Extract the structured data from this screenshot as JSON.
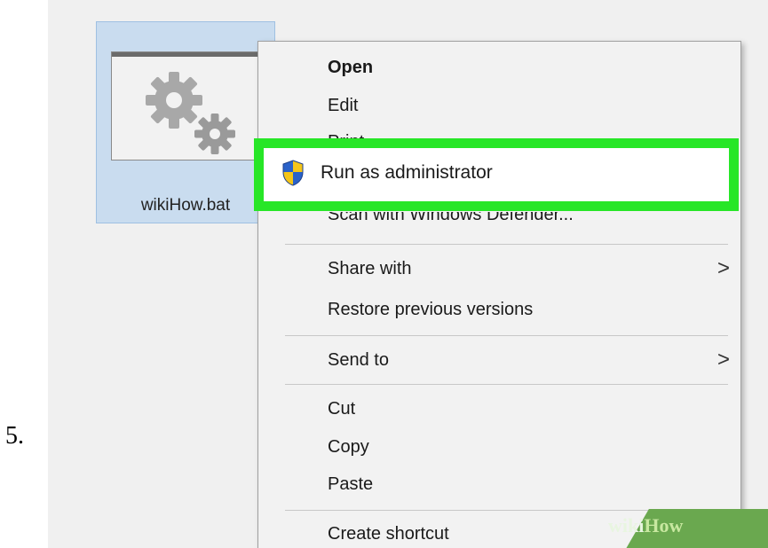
{
  "step": {
    "number": "5."
  },
  "file": {
    "name": "wikiHow.bat",
    "thumbnail_icon": "gears-icon"
  },
  "context_menu": {
    "items": [
      {
        "label": "Open"
      },
      {
        "label": "Edit"
      },
      {
        "label": "Print"
      },
      {
        "label": "Run as administrator",
        "icon": "uac-shield-icon"
      },
      {
        "label": "Scan with Windows Defender..."
      },
      {
        "label": "Share with",
        "submenu": ">"
      },
      {
        "label": "Restore previous versions"
      },
      {
        "label": "Send to",
        "submenu": ">"
      },
      {
        "label": "Cut"
      },
      {
        "label": "Copy"
      },
      {
        "label": "Paste"
      },
      {
        "label": "Create shortcut"
      }
    ]
  },
  "watermark": {
    "part1": "wiki",
    "part2": "How"
  },
  "colors": {
    "highlight": "#27e627",
    "selection": "#c9dcef",
    "menu_bg": "#f2f2f2",
    "watermark": "#6aa84f"
  }
}
